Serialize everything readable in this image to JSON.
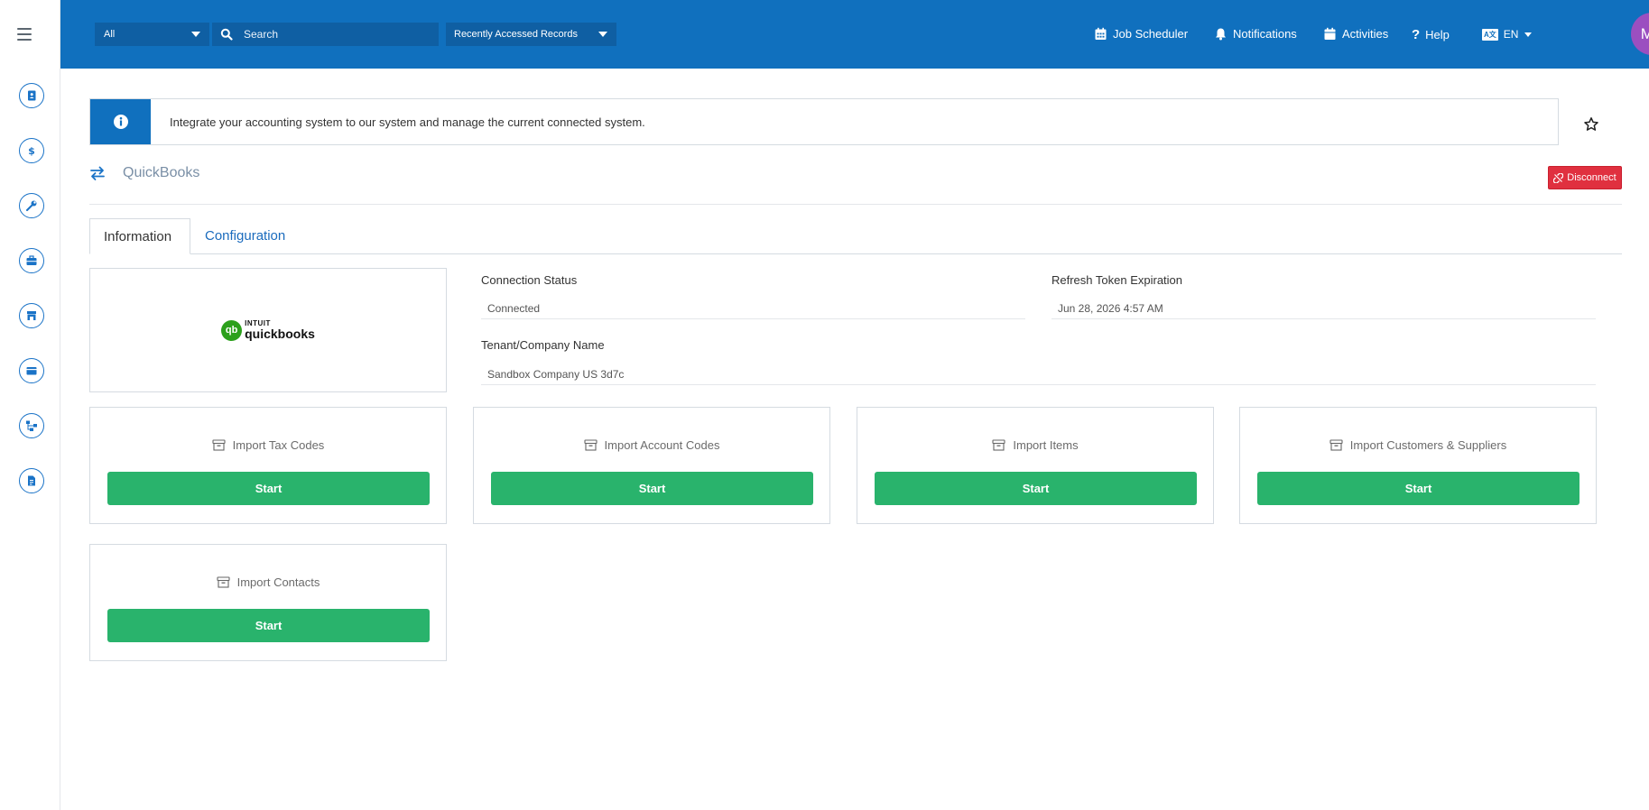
{
  "topbar": {
    "scope": "All",
    "search_placeholder": "Search",
    "recent": "Recently Accessed Records",
    "job_scheduler": "Job Scheduler",
    "notifications": "Notifications",
    "activities": "Activities",
    "help": "Help",
    "language": "EN",
    "avatar_initials": "MS"
  },
  "banner": {
    "text": "Integrate your accounting system to our system and manage the current connected system."
  },
  "integration": {
    "title": "QuickBooks",
    "disconnect_label": "Disconnect"
  },
  "tabs": [
    {
      "label": "Information"
    },
    {
      "label": "Configuration"
    }
  ],
  "logo": {
    "brand_top": "INTUIT",
    "brand_name": "quickbooks",
    "mark": "qb"
  },
  "fields": {
    "connection_status": {
      "label": "Connection Status",
      "value": "Connected"
    },
    "refresh_token": {
      "label": "Refresh Token Expiration",
      "value": "Jun 28, 2026 4:57 AM"
    },
    "tenant": {
      "label": "Tenant/Company Name",
      "value": "Sandbox Company US 3d7c"
    }
  },
  "imports": [
    {
      "title": "Import Tax Codes",
      "button": "Start"
    },
    {
      "title": "Import Account Codes",
      "button": "Start"
    },
    {
      "title": "Import Items",
      "button": "Start"
    },
    {
      "title": "Import Customers & Suppliers",
      "button": "Start"
    },
    {
      "title": "Import Contacts",
      "button": "Start"
    }
  ],
  "colors": {
    "topbar": "#1070be",
    "accent": "#1070be",
    "start_button": "#29b36c",
    "disconnect": "#e0303f",
    "avatar": "#9b4fc0"
  },
  "icons": {
    "sidebar": [
      "contact-book-icon",
      "dollar-icon",
      "wrench-icon",
      "briefcase-icon",
      "store-icon",
      "wallet-icon",
      "sitemap-icon",
      "file-icon"
    ]
  }
}
